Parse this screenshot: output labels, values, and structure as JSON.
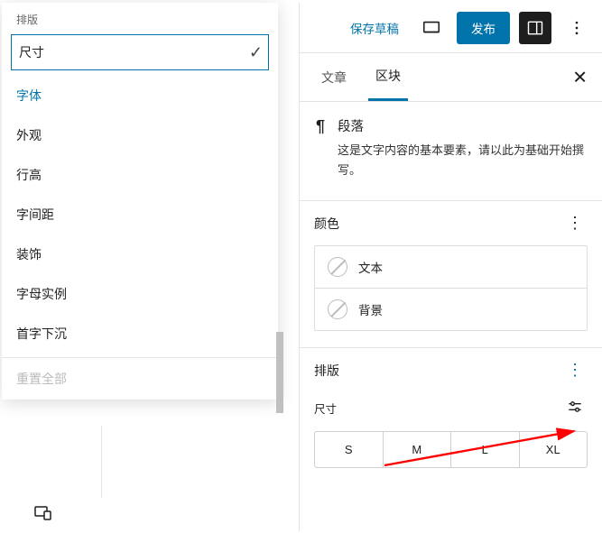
{
  "dropdown": {
    "title": "排版",
    "items": [
      {
        "label": "尺寸",
        "selected": true
      },
      {
        "label": "字体",
        "blue": true
      },
      {
        "label": "外观"
      },
      {
        "label": "行高"
      },
      {
        "label": "字间距"
      },
      {
        "label": "装饰"
      },
      {
        "label": "字母实例"
      },
      {
        "label": "首字下沉"
      }
    ],
    "reset": "重置全部"
  },
  "topbar": {
    "save_draft": "保存草稿",
    "publish": "发布"
  },
  "tabs": {
    "post": "文章",
    "block": "区块"
  },
  "block": {
    "name": "段落",
    "hint": "这是文字内容的基本要素，请以此为基础开始撰写。"
  },
  "color": {
    "title": "颜色",
    "text": "文本",
    "bg": "背景"
  },
  "typo": {
    "title": "排版",
    "size_label": "尺寸",
    "sizes": [
      "S",
      "M",
      "L",
      "XL"
    ]
  }
}
